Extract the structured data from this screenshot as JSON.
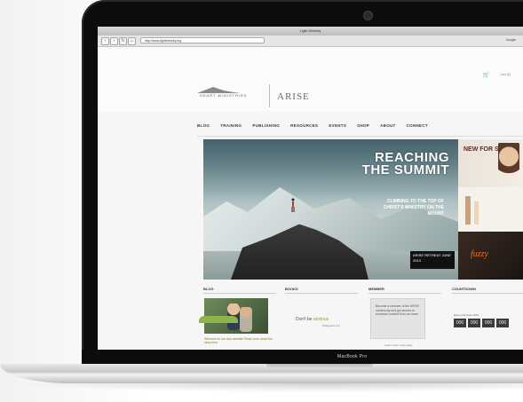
{
  "window": {
    "title": "Light Ministry"
  },
  "browser": {
    "url": "http://www.lightministry.org",
    "right_label": "Google"
  },
  "header": {
    "logo_text": "HEART MINISTRIES",
    "brand": "ARISE",
    "cart_label": "Cart (0)"
  },
  "nav": {
    "items": [
      "BLOG",
      "TRAINING",
      "PUBLISHING",
      "RESOURCES",
      "EVENTS",
      "SHOP",
      "ABOUT",
      "CONNECT"
    ]
  },
  "hero": {
    "title_line1": "REACHING",
    "title_line2": "THE SUMMIT",
    "subtitle": "CLIMBING TO THE TOP OF CHRIST'S MINISTRY ON THE MOUNT",
    "badge": "ARISE RETREAT JUNE 2013"
  },
  "side_panels": {
    "panel1_text": "NEW FOR SPRING",
    "panel3_text": "fuzzy"
  },
  "columns": {
    "blog": {
      "heading": "BLOG",
      "caption": "Welcome to our new website! Read more about the story here."
    },
    "books": {
      "heading": "BOOKS",
      "quote_prefix": "Don't be ",
      "quote_highlight": "anxious",
      "quote_sub": "Philippians 4:6"
    },
    "member": {
      "heading": "MEMBER",
      "text": "Become a member of the ARISE community and get access to exclusive content from our team.",
      "link": "Learn more / Join today"
    },
    "countdown": {
      "heading": "COUNTDOWN",
      "label": "Days until Arise 2013",
      "values": [
        "000",
        "000",
        "000",
        "000"
      ]
    }
  },
  "laptop": {
    "brand": "MacBook Pro"
  },
  "colors": {
    "accent_green": "#8fb44a",
    "accent_red": "#7a1d18",
    "accent_orange": "#e86e2d"
  }
}
